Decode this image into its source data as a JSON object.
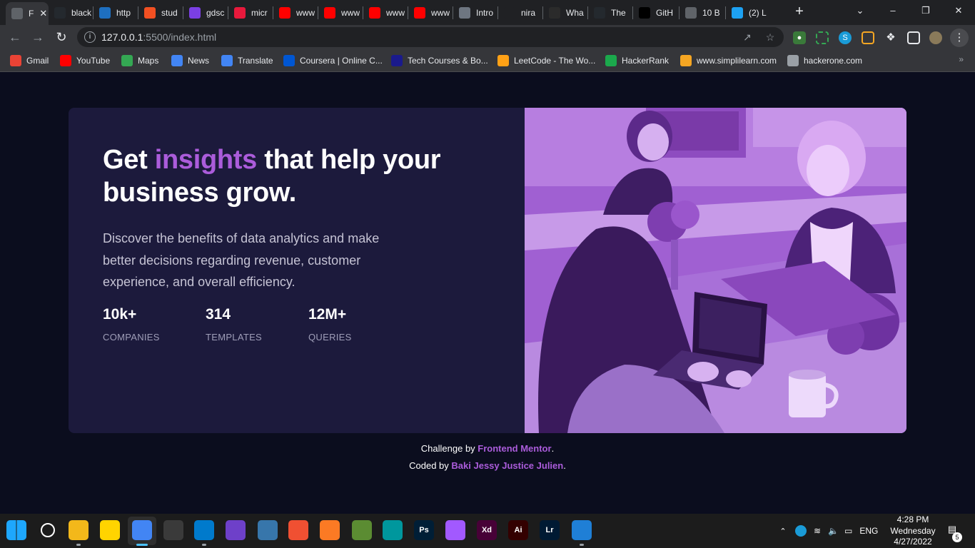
{
  "browser": {
    "tabs": [
      {
        "label": "F",
        "icon": "chrome-icon",
        "color": "#5f6368",
        "active": true
      },
      {
        "label": "black",
        "icon": "github-icon",
        "color": "#24292e"
      },
      {
        "label": "http",
        "icon": "play-icon",
        "color": "#1e6fc0"
      },
      {
        "label": "stud",
        "icon": "microsoft-icon",
        "color": "#f25022"
      },
      {
        "label": "gdsc",
        "icon": "u-icon",
        "color": "#7b3fe4"
      },
      {
        "label": "micr",
        "icon": "heart-icon",
        "color": "#e8193c"
      },
      {
        "label": "www",
        "icon": "youtube-icon",
        "color": "#ff0000"
      },
      {
        "label": "www",
        "icon": "youtube-icon",
        "color": "#ff0000"
      },
      {
        "label": "www",
        "icon": "youtube-icon",
        "color": "#ff0000"
      },
      {
        "label": "www",
        "icon": "youtube-icon",
        "color": "#ff0000"
      },
      {
        "label": "Intro",
        "icon": "cat-icon",
        "color": "#6e7681"
      },
      {
        "label": "nira",
        "icon": "n-icon",
        "color": "#202124"
      },
      {
        "label": "Wha",
        "icon": "terminal-icon",
        "color": "#2b2b2b"
      },
      {
        "label": "The",
        "icon": "github-icon",
        "color": "#24292e"
      },
      {
        "label": "GitH",
        "icon": "dev-icon",
        "color": "#000000"
      },
      {
        "label": "10 B",
        "icon": "globe-icon",
        "color": "#5f6368"
      },
      {
        "label": "(2) L",
        "icon": "twitter-icon",
        "color": "#1da1f2"
      }
    ],
    "address": {
      "host": "127.0.0.1",
      "rest": ":5500/index.html"
    },
    "bookmarks": [
      {
        "label": "Gmail",
        "icon": "gmail-icon",
        "color": "#ea4335"
      },
      {
        "label": "YouTube",
        "icon": "youtube-icon",
        "color": "#ff0000"
      },
      {
        "label": "Maps",
        "icon": "maps-icon",
        "color": "#34a853"
      },
      {
        "label": "News",
        "icon": "news-icon",
        "color": "#4285f4"
      },
      {
        "label": "Translate",
        "icon": "translate-icon",
        "color": "#4285f4"
      },
      {
        "label": "Coursera | Online C...",
        "icon": "coursera-icon",
        "color": "#0056d2"
      },
      {
        "label": "Tech Courses & Bo...",
        "icon": "f-icon",
        "color": "#1a1a8c"
      },
      {
        "label": "LeetCode - The Wo...",
        "icon": "leetcode-icon",
        "color": "#ffa116"
      },
      {
        "label": "HackerRank",
        "icon": "hackerrank-icon",
        "color": "#1ba94c"
      },
      {
        "label": "www.simplilearn.com",
        "icon": "simplilearn-icon",
        "color": "#f5a623"
      },
      {
        "label": "hackerone.com",
        "icon": "globe-icon",
        "color": "#9aa0a6"
      }
    ]
  },
  "page": {
    "headline_pre": "Get ",
    "headline_accent": "insights",
    "headline_post": " that help your business grow.",
    "description": "Discover the benefits of data analytics and make better decisions regarding revenue, customer experience, and overall efficiency.",
    "stats": [
      {
        "value": "10k+",
        "label": "COMPANIES"
      },
      {
        "value": "314",
        "label": "TEMPLATES"
      },
      {
        "value": "12M+",
        "label": "QUERIES"
      }
    ],
    "attribution": {
      "challenge_pre": "Challenge by ",
      "challenge_link": "Frontend Mentor",
      "challenge_post": ".",
      "coded_pre": "Coded by ",
      "coded_link": "Baki Jessy Justice Julien",
      "coded_post": "."
    },
    "colors": {
      "accent": "#ab5cdb",
      "card": "#1c1a3c",
      "background": "#0b0d1e"
    }
  },
  "taskbar": {
    "apps": [
      {
        "name": "start-icon",
        "glyph": "",
        "color": "#0078d4"
      },
      {
        "name": "search-icon",
        "glyph": "",
        "color": "#1c1c1c"
      },
      {
        "name": "file-explorer-icon",
        "glyph": "",
        "color": "#f3b81a"
      },
      {
        "name": "sticky-notes-icon",
        "glyph": "",
        "color": "#ffd400"
      },
      {
        "name": "chrome-icon",
        "glyph": "",
        "color": "#4285f4"
      },
      {
        "name": "obs-icon",
        "glyph": "",
        "color": "#3a3a3a"
      },
      {
        "name": "vscode-icon",
        "glyph": "",
        "color": "#007acc"
      },
      {
        "name": "github-desktop-icon",
        "glyph": "",
        "color": "#6e40c9"
      },
      {
        "name": "python-icon",
        "glyph": "",
        "color": "#3776ab"
      },
      {
        "name": "git-icon",
        "glyph": "",
        "color": "#f05032"
      },
      {
        "name": "xampp-icon",
        "glyph": "",
        "color": "#fb7a24"
      },
      {
        "name": "minecraft-icon",
        "glyph": "",
        "color": "#5b8c32"
      },
      {
        "name": "arduino-icon",
        "glyph": "",
        "color": "#00979d"
      },
      {
        "name": "photoshop-icon",
        "glyph": "Ps",
        "color": "#001e36"
      },
      {
        "name": "figma-icon",
        "glyph": "",
        "color": "#a259ff"
      },
      {
        "name": "adobe-xd-icon",
        "glyph": "Xd",
        "color": "#470137"
      },
      {
        "name": "illustrator-icon",
        "glyph": "Ai",
        "color": "#330000"
      },
      {
        "name": "lightroom-icon",
        "glyph": "Lr",
        "color": "#001a33"
      },
      {
        "name": "photos-icon",
        "glyph": "",
        "color": "#1f7fd6"
      }
    ],
    "language": "ENG",
    "time": "4:28 PM",
    "day": "Wednesday",
    "date": "4/27/2022",
    "notifications": "5"
  }
}
